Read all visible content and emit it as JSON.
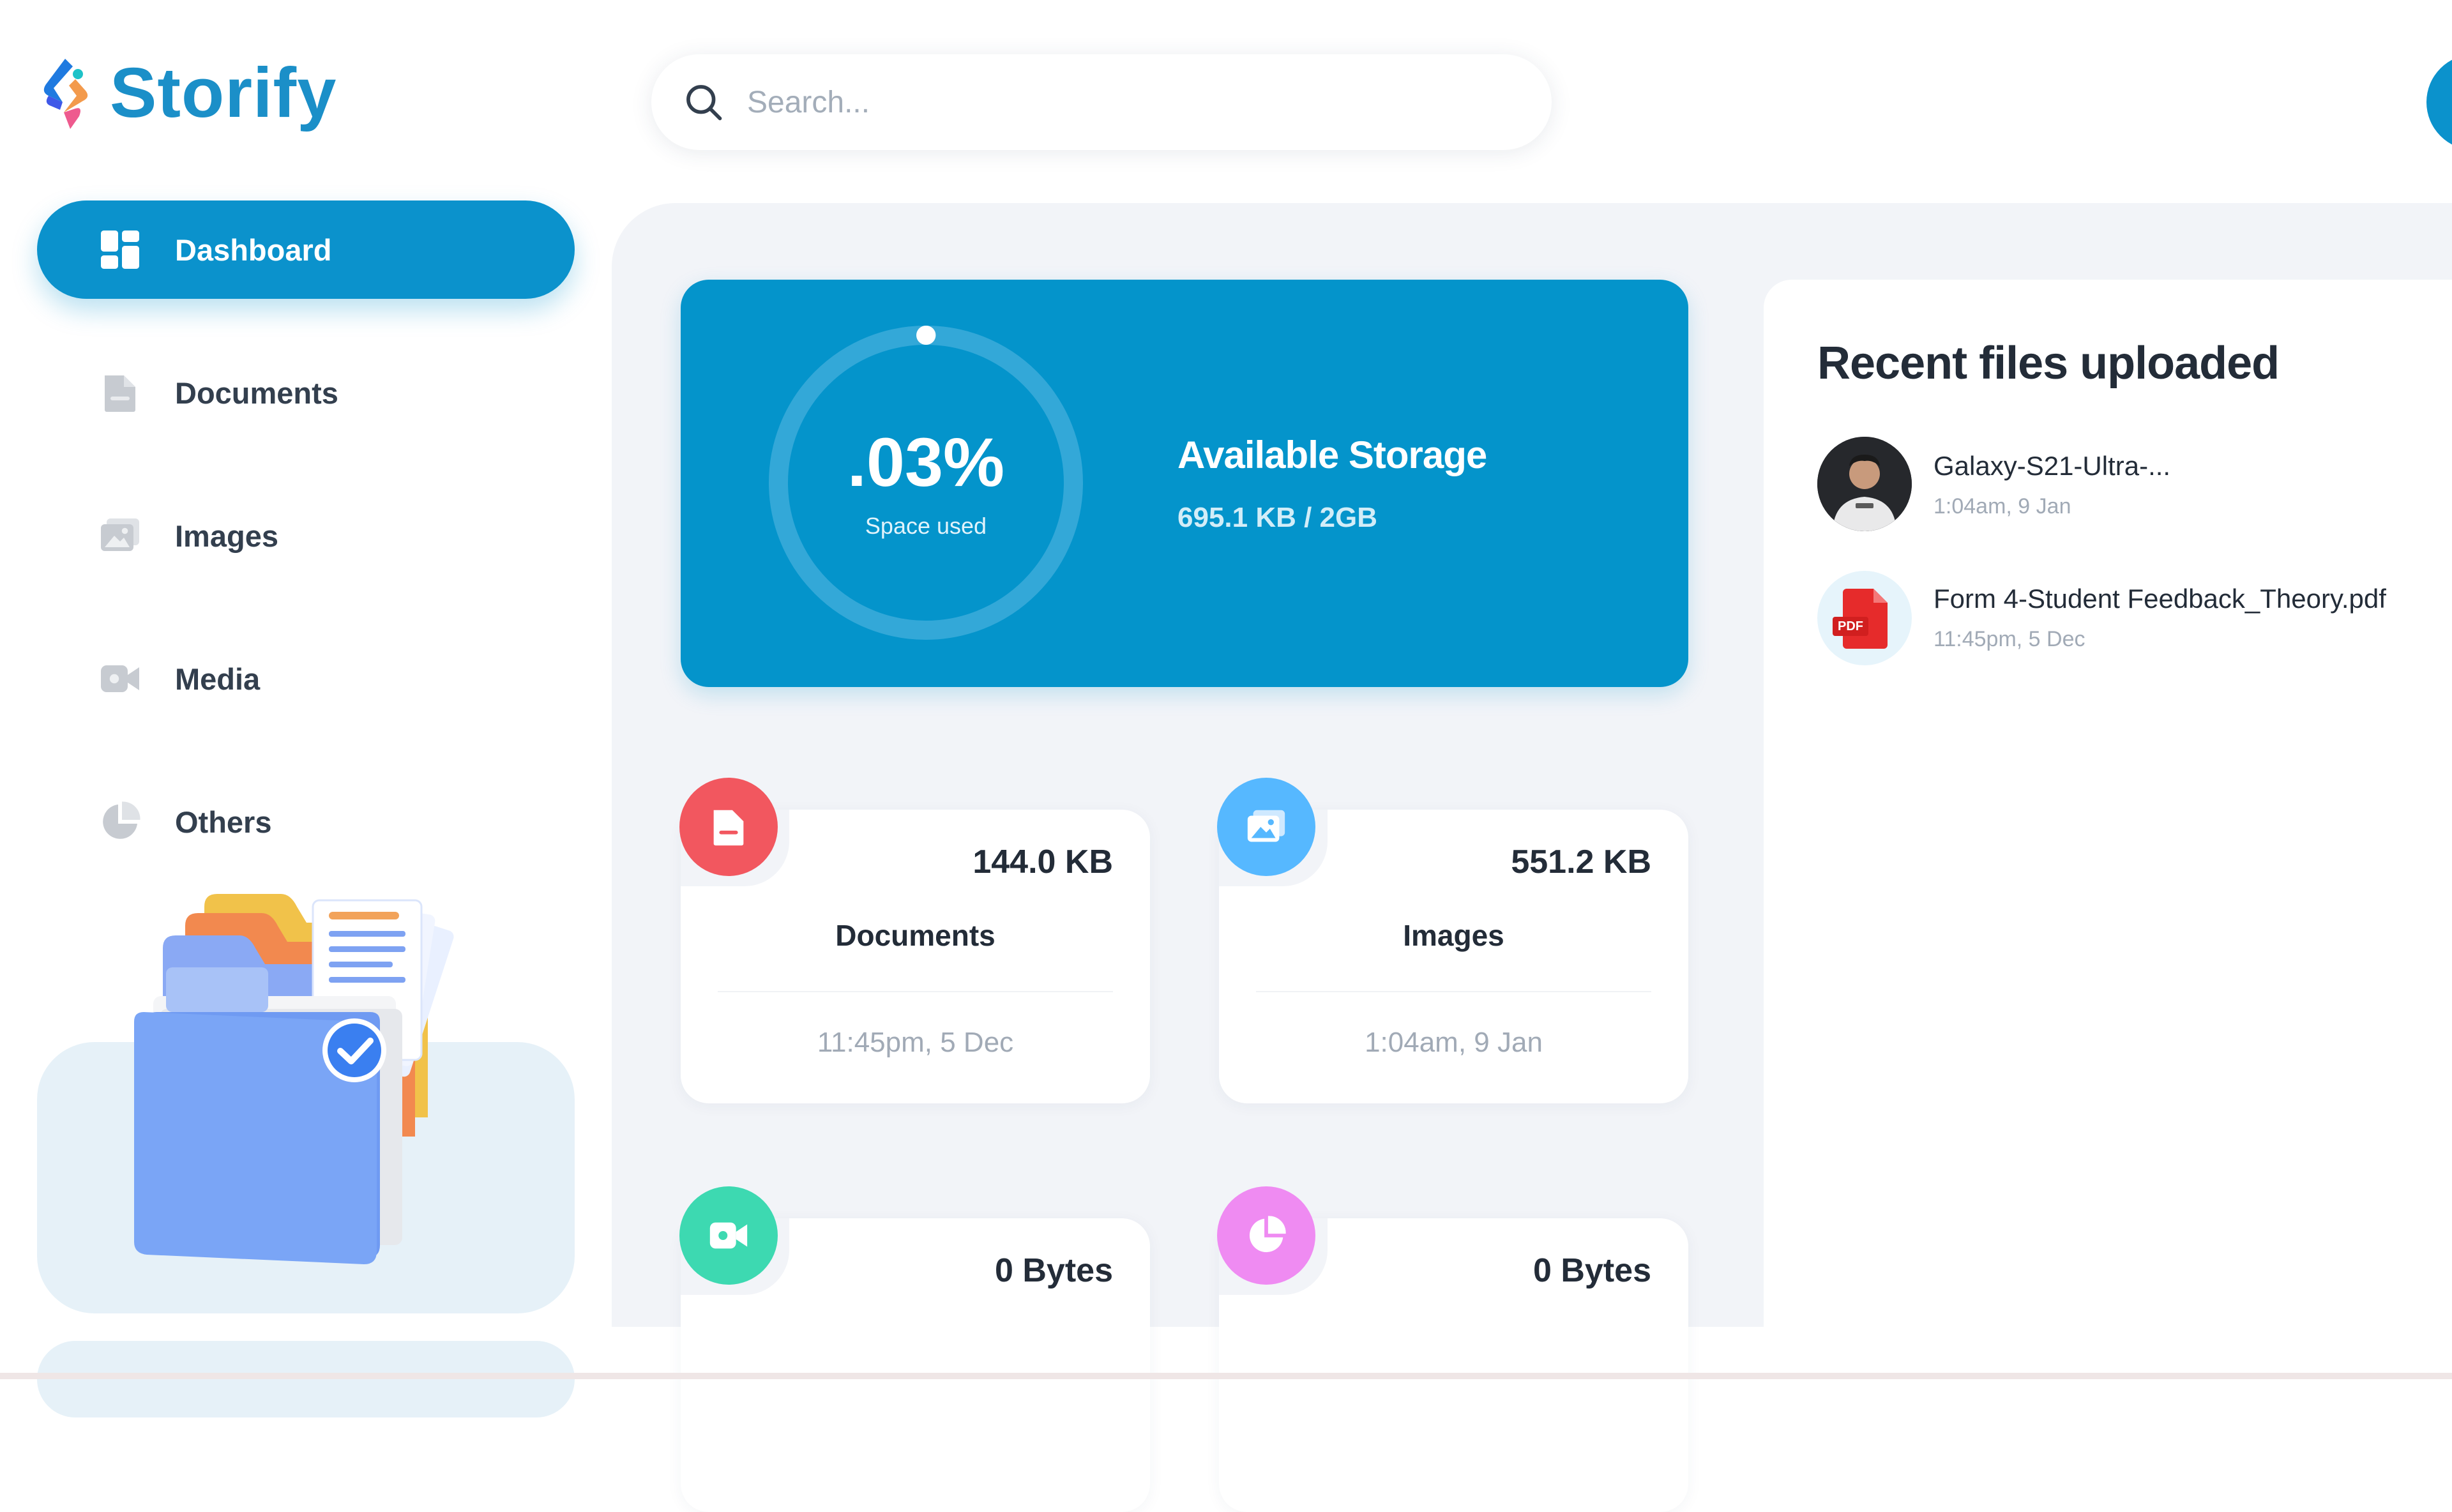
{
  "app": {
    "name": "Storify"
  },
  "search": {
    "placeholder": "Search..."
  },
  "sidebar": {
    "items": [
      {
        "label": "Dashboard",
        "icon": "dashboard-grid-icon",
        "active": true
      },
      {
        "label": "Documents",
        "icon": "document-icon",
        "active": false
      },
      {
        "label": "Images",
        "icon": "image-icon",
        "active": false
      },
      {
        "label": "Media",
        "icon": "video-icon",
        "active": false
      },
      {
        "label": "Others",
        "icon": "pie-chart-icon",
        "active": false
      }
    ]
  },
  "storage": {
    "percent_label": ".03%",
    "percent_value": 0.03,
    "space_used_label": "Space used",
    "title": "Available Storage",
    "usage": "695.1 KB / 2GB"
  },
  "categories": [
    {
      "title": "Documents",
      "size": "144.0 KB",
      "date": "11:45pm, 5 Dec",
      "icon": "document-icon",
      "color": "#f2575f"
    },
    {
      "title": "Images",
      "size": "551.2 KB",
      "date": "1:04am, 9 Jan",
      "icon": "image-icon",
      "color": "#56b8ff"
    },
    {
      "title": "",
      "size": "0 Bytes",
      "date": "",
      "icon": "video-icon",
      "color": "#3dd9b1"
    },
    {
      "title": "",
      "size": "0 Bytes",
      "date": "",
      "icon": "pie-chart-icon",
      "color": "#ef8bf2"
    }
  ],
  "recent": {
    "title": "Recent files uploaded",
    "files": [
      {
        "name": "Galaxy-S21-Ultra-...",
        "date": "1:04am, 9 Jan",
        "thumb": "user-photo"
      },
      {
        "name": "Form 4-Student Feedback_Theory.pdf",
        "date": "11:45pm, 5 Dec",
        "thumb": "pdf-icon",
        "badge": "PDF"
      }
    ]
  },
  "colors": {
    "brand": "#0b92cc",
    "text": "#333f4e",
    "panel": "#f2f4f8"
  }
}
